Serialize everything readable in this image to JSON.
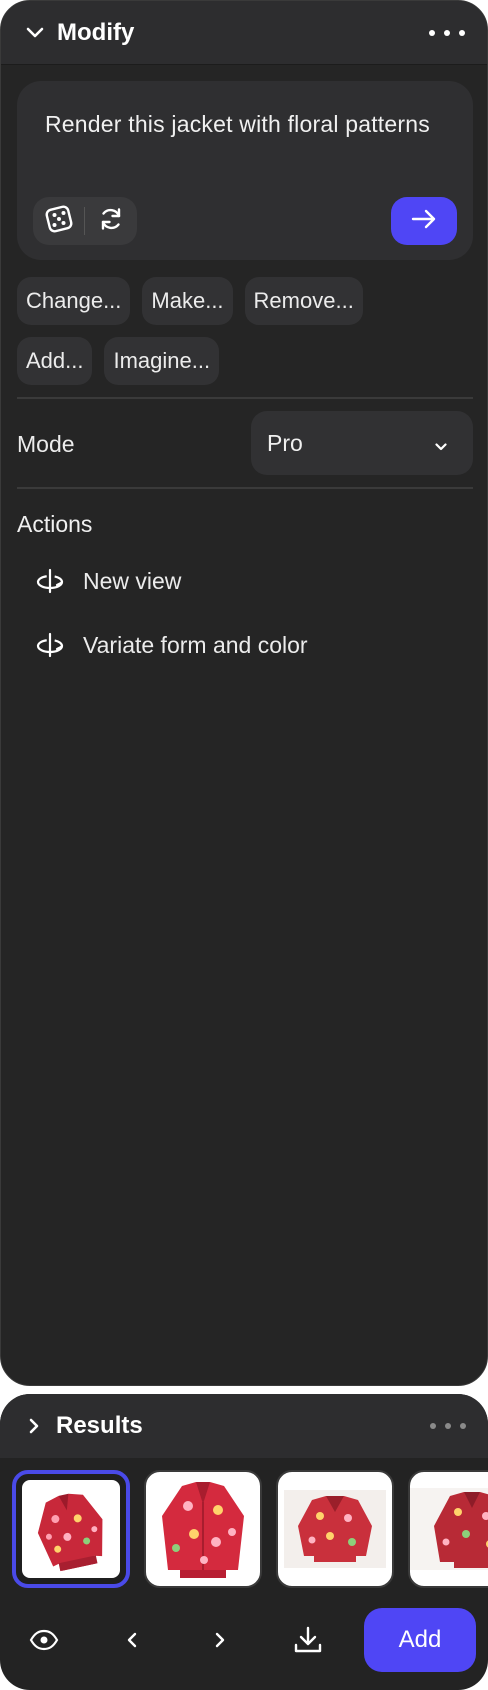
{
  "modify": {
    "title": "Modify",
    "prompt": "Render this jacket with floral patterns",
    "suggestions_row1": [
      "Change...",
      "Make...",
      "Remove..."
    ],
    "suggestions_row2": [
      "Add...",
      "Imagine..."
    ],
    "mode_label": "Mode",
    "mode_value": "Pro",
    "actions_title": "Actions",
    "actions": [
      "New view",
      "Variate form and color"
    ]
  },
  "results": {
    "title": "Results",
    "add_label": "Add",
    "selected_index": 0
  },
  "colors": {
    "accent": "#4f46f5",
    "panel": "#252525",
    "header": "#2d2d2f"
  }
}
